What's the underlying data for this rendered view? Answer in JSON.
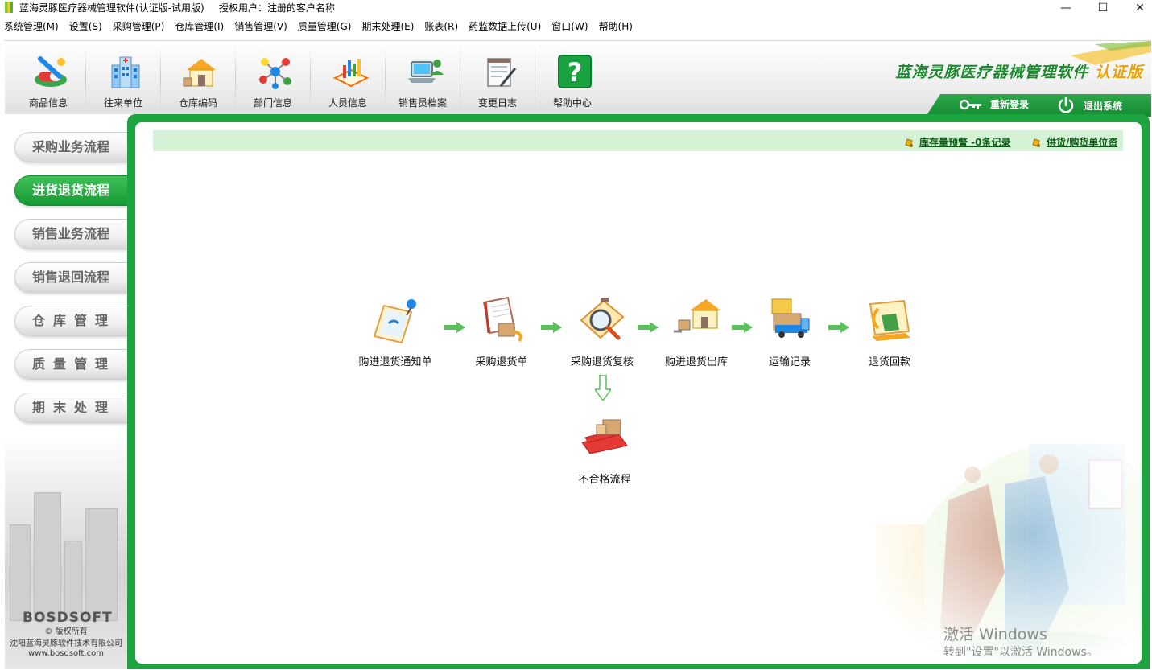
{
  "window": {
    "title": "蓝海灵豚医疗器械管理软件(认证版-试用版)",
    "auth_user": "授权用户：注册的客户名称",
    "controls": {
      "minimize": "—",
      "maximize": "☐",
      "close": "✕"
    }
  },
  "menu": [
    "系统管理(M)",
    "设置(S)",
    "采购管理(P)",
    "仓库管理(I)",
    "销售管理(V)",
    "质量管理(G)",
    "期末处理(E)",
    "账表(R)",
    "药监数据上传(U)",
    "窗口(W)",
    "帮助(H)"
  ],
  "toolbar": {
    "items": [
      {
        "label": "商品信息",
        "icon": "capsule-icon"
      },
      {
        "label": "往来单位",
        "icon": "hospital-building-icon"
      },
      {
        "label": "仓库编码",
        "icon": "warehouse-icon"
      },
      {
        "label": "部门信息",
        "icon": "network-nodes-icon"
      },
      {
        "label": "人员信息",
        "icon": "staff-chart-icon"
      },
      {
        "label": "销售员档案",
        "icon": "laptop-user-icon"
      },
      {
        "label": "变更日志",
        "icon": "notepad-pen-icon"
      },
      {
        "label": "帮助中心",
        "icon": "help-question-icon"
      }
    ],
    "brand": {
      "name": "蓝海灵豚医疗器械管理软件",
      "edition": "认证版"
    },
    "relogin_label": "重新登录",
    "exit_label": "退出系统"
  },
  "sidebar": {
    "items": [
      {
        "label": "采购业务流程",
        "active": false
      },
      {
        "label": "进货退货流程",
        "active": true
      },
      {
        "label": "销售业务流程",
        "active": false
      },
      {
        "label": "销售退回流程",
        "active": false
      },
      {
        "label": "仓库管理",
        "active": false
      },
      {
        "label": "质量管理",
        "active": false
      },
      {
        "label": "期末处理",
        "active": false
      }
    ],
    "logo": "BOSDSOFT",
    "copyright": "© 版权所有",
    "company": "沈阳蓝海灵豚软件技术有限公司",
    "website": "www.bosdsoft.com"
  },
  "infobar": {
    "stock_alert": "库存量预警 -0条记录",
    "supplier_info": "供货/购货单位资"
  },
  "flow": {
    "steps": [
      {
        "label": "购进退货通知单",
        "icon": "notice-pin-icon"
      },
      {
        "label": "采购退货单",
        "icon": "return-document-icon"
      },
      {
        "label": "采购退货复核",
        "icon": "magnifier-review-icon"
      },
      {
        "label": "购进退货出库",
        "icon": "warehouse-out-icon"
      },
      {
        "label": "运输记录",
        "icon": "truck-icon"
      },
      {
        "label": "退货回款",
        "icon": "refund-icon"
      }
    ],
    "branch": {
      "label": "不合格流程",
      "icon": "defective-cart-icon"
    }
  },
  "watermark": {
    "line1": "激活 Windows",
    "line2": "转到\"设置\"以激活 Windows。"
  },
  "colors": {
    "primary_green": "#1ea341",
    "infobar_bg": "#d6f2d6",
    "brand_orange": "#f0a000"
  }
}
